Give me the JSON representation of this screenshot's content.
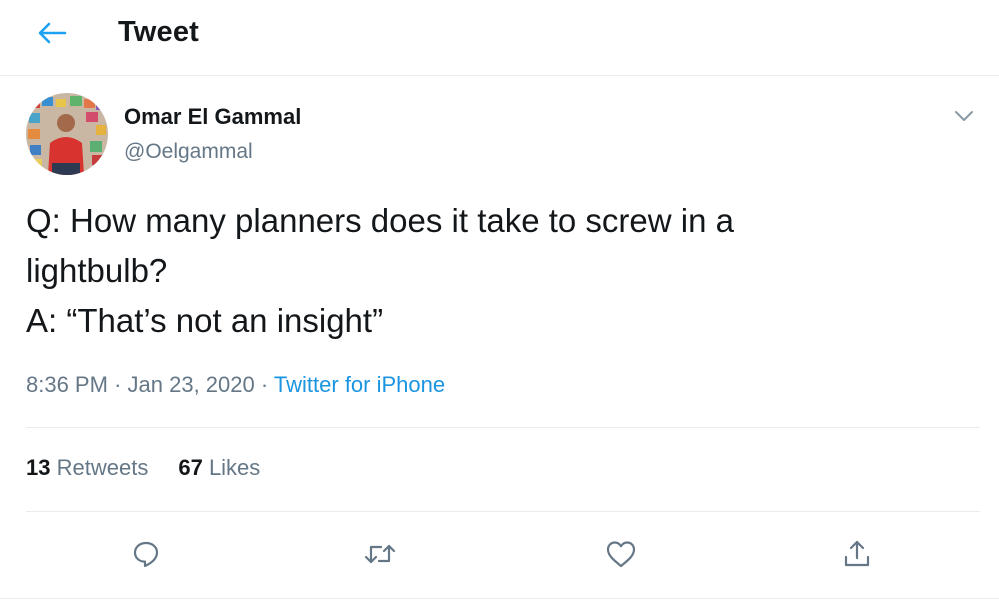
{
  "header": {
    "title": "Tweet",
    "back_icon": "arrow-left-icon"
  },
  "tweet": {
    "author": {
      "name": "Omar El Gammal",
      "handle": "@Oelgammal"
    },
    "text_lines": [
      "Q: How many planners does it take to screw in a",
      "lightbulb?",
      "A: “That’s not an insight”"
    ],
    "time": "8:36 PM",
    "date": "Jan 23, 2020",
    "separator": "·",
    "source": "Twitter for iPhone",
    "stats": {
      "retweets_count": "13",
      "retweets_label": "Retweets",
      "likes_count": "67",
      "likes_label": "Likes"
    },
    "actions": [
      "reply-icon",
      "retweet-icon",
      "like-icon",
      "share-icon"
    ]
  },
  "colors": {
    "accent": "#1da1f2",
    "link": "#1b95e0",
    "secondary_text": "#657786",
    "divider": "#e6ecf0"
  }
}
